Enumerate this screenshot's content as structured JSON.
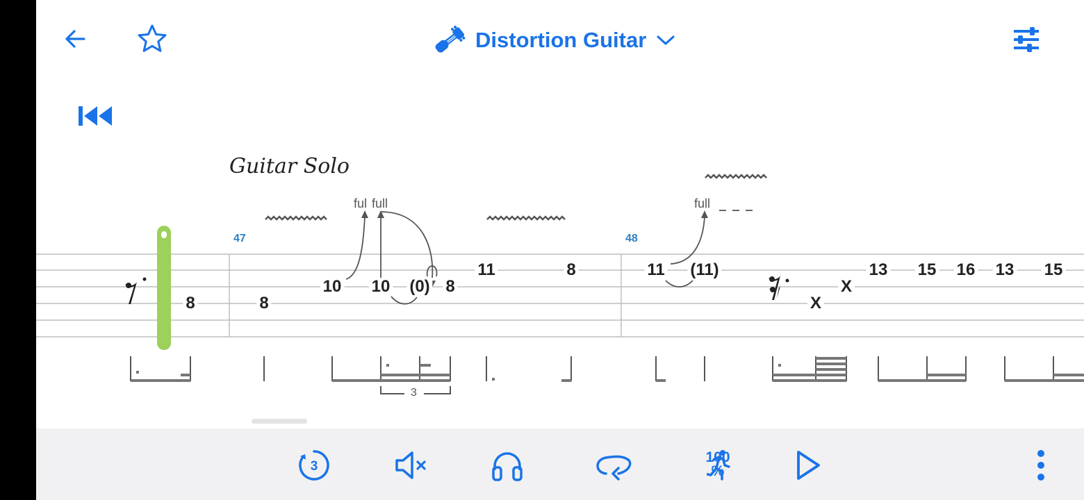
{
  "top_bar": {
    "title": "Distortion Guitar",
    "icons": [
      "back-arrow-icon",
      "star-outline-icon",
      "guitar-icon",
      "chevron-down-icon",
      "mixer-settings-icon"
    ]
  },
  "rewind": {
    "icon": "skip-to-start-icon"
  },
  "score": {
    "section_label": "Guitar Solo",
    "measures": [
      "47",
      "48"
    ],
    "frets": {
      "f1": "8",
      "f2": "8",
      "f3": "10",
      "f4": "10",
      "f5": "(0)",
      "f6": "8",
      "f7": "11",
      "f8": "8",
      "f9": "11",
      "f10": "(11)",
      "f11": "X",
      "f12": "X",
      "f13": "13",
      "f14": "15",
      "f15": "16",
      "f16": "13",
      "f17": "15"
    },
    "bends": {
      "b1": "ful",
      "b2": "full",
      "b3": "full"
    },
    "tuplet": "3"
  },
  "bottom_bar": {
    "countdown_value": "3",
    "tempo_value": "100",
    "tempo_unit": "%",
    "icons": [
      "countdown-icon",
      "mute-icon",
      "headphones-icon",
      "loop-icon",
      "tempo-runner-icon",
      "play-icon",
      "more-vert-icon"
    ]
  },
  "colors": {
    "accent": "#1a73e8",
    "cursor": "#9cd15a",
    "bottom_bar_bg": "#f1f1f3"
  }
}
